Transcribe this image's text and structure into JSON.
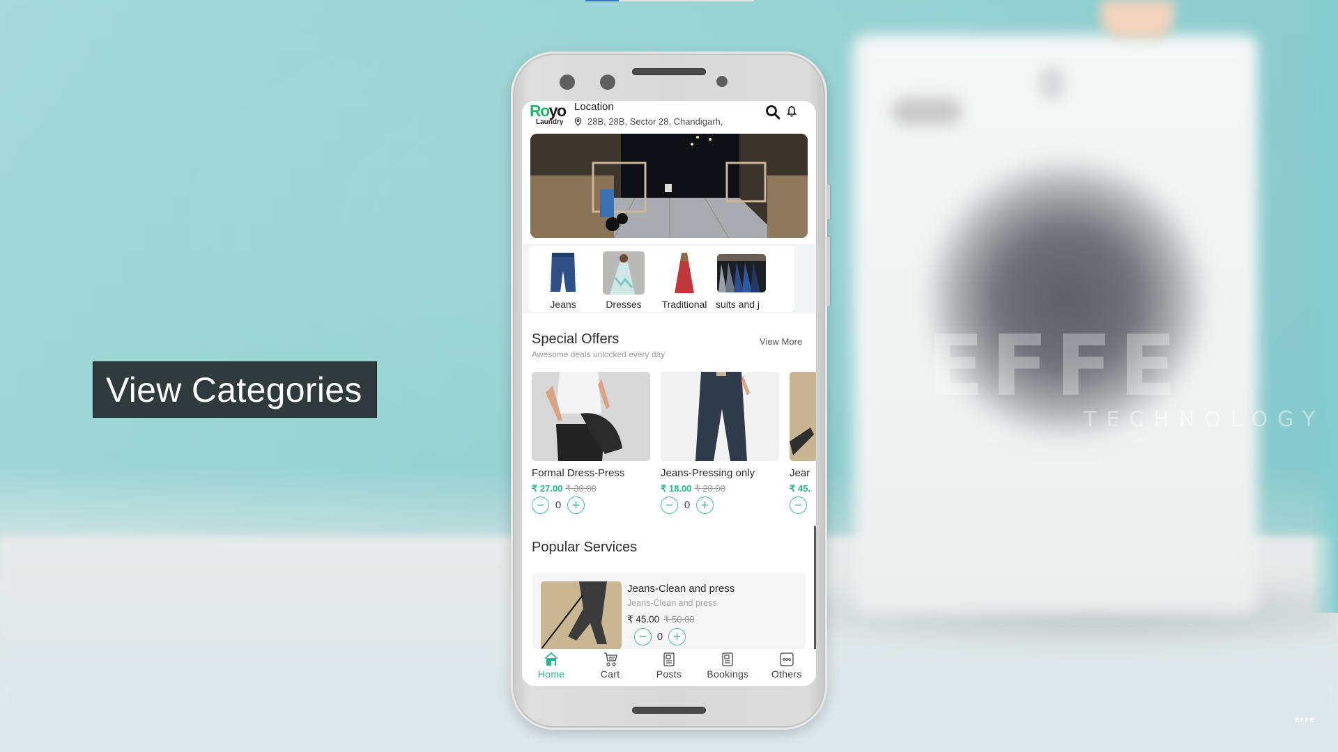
{
  "video": {
    "progress_fraction": 0.2,
    "caption": "View Categories",
    "watermark_logo": "EFFE",
    "watermark_tagline": "TECHNOLOGY",
    "corner_logo": "EFFE"
  },
  "app": {
    "logo": {
      "part1": "Ro",
      "part2": "yo",
      "subtitle": "Laundry"
    },
    "header": {
      "location_label": "Location",
      "address": "28B, 28B, Sector 28, Chandigarh,",
      "icons": [
        "location-pin-icon",
        "search-icon",
        "bell-icon"
      ]
    },
    "categories": [
      {
        "label": "Jeans",
        "image": "jeans-image"
      },
      {
        "label": "Dresses",
        "image": "dress-image"
      },
      {
        "label": "Traditional",
        "image": "traditional-dress-image"
      },
      {
        "label": "suits and j",
        "image": "suits-image"
      }
    ],
    "special_offers": {
      "title": "Special Offers",
      "subtitle": "Awesome deals unlocked every day",
      "view_more": "View More",
      "items": [
        {
          "name": "Formal Dress-Press",
          "price": "₹ 27.00",
          "old_price": "₹ 30.00",
          "qty": "0"
        },
        {
          "name": "Jeans-Pressing only",
          "price": "₹ 18.00",
          "old_price": "₹ 20.00",
          "qty": "0"
        },
        {
          "name": "Jear",
          "price": "₹ 45.",
          "old_price": "",
          "qty": ""
        }
      ]
    },
    "popular_services": {
      "title": "Popular Services",
      "items": [
        {
          "name": "Jeans-Clean and press",
          "description": "Jeans-Clean and press",
          "price": "₹ 45.00",
          "old_price": "₹ 50.00",
          "qty": "0"
        }
      ]
    },
    "qty_minus": "−",
    "qty_plus": "+",
    "bottom_nav": [
      {
        "label": "Home",
        "icon": "home-icon",
        "active": true
      },
      {
        "label": "Cart",
        "icon": "cart-icon",
        "active": false
      },
      {
        "label": "Posts",
        "icon": "posts-icon",
        "active": false
      },
      {
        "label": "Bookings",
        "icon": "bookings-icon",
        "active": false
      },
      {
        "label": "Others",
        "icon": "more-icon",
        "active": false
      }
    ],
    "colors": {
      "accent": "#2fb38f",
      "logo_green": "#27b36b",
      "stepper": "#49b9a6"
    }
  }
}
